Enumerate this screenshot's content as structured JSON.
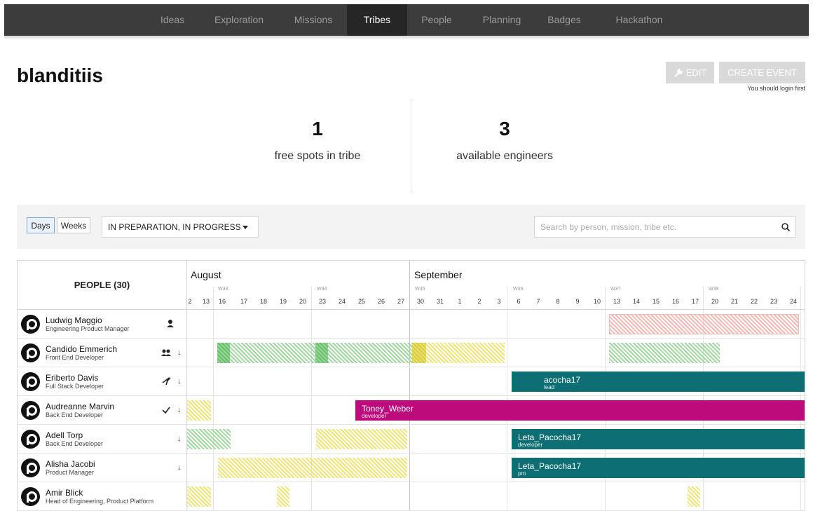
{
  "nav": {
    "items": [
      "Ideas",
      "Exploration",
      "Missions",
      "Tribes",
      "People",
      "Planning",
      "Badges",
      "Hackathon"
    ],
    "active": "Tribes"
  },
  "page": {
    "title": "blanditiis",
    "edit_label": "EDIT",
    "create_label": "CREATE EVENT",
    "login_note": "You should login first"
  },
  "stats": {
    "free_spots": "1",
    "free_spots_label": "free spots in tribe",
    "engineers": "3",
    "engineers_label": "available engineers"
  },
  "filters": {
    "days_label": "Days",
    "weeks_label": "Weeks",
    "active_toggle": "Days",
    "status_value": "IN PREPARATION, IN PROGRESS",
    "search_placeholder": "Search by person, mission, tribe etc."
  },
  "timeline": {
    "people_header": "PEOPLE (30)",
    "months": [
      "August",
      "September"
    ],
    "weeks": [
      "W33",
      "W34",
      "W35",
      "W36",
      "W37",
      "W38"
    ],
    "days": [
      "2",
      "13",
      "16",
      "17",
      "18",
      "19",
      "20",
      "23",
      "24",
      "25",
      "26",
      "27",
      "30",
      "31",
      "1",
      "2",
      "3",
      "6",
      "7",
      "8",
      "9",
      "10",
      "13",
      "14",
      "15",
      "16",
      "17",
      "20",
      "21",
      "22",
      "23",
      "24"
    ]
  },
  "people": [
    {
      "name": "Ludwig Maggio",
      "role": "Engineering Product Manager",
      "icon": "person-icon",
      "arrow": ""
    },
    {
      "name": "Candido Emmerich",
      "role": "Front End Developer",
      "icon": "group-icon",
      "arrow": "↓"
    },
    {
      "name": "Eriberto Davis",
      "role": "Full Stack Developer",
      "icon": "signature-icon",
      "arrow": "↓"
    },
    {
      "name": "Audreanne Marvin",
      "role": "Back End Developer",
      "icon": "check-icon",
      "arrow": "↓"
    },
    {
      "name": "Adell Torp",
      "role": "Back End Developer",
      "icon": "",
      "arrow": "↓"
    },
    {
      "name": "Alisha Jacobi",
      "role": "Product Manager",
      "icon": "",
      "arrow": "↓"
    },
    {
      "name": "Amir Blick",
      "role": "Head of Engineering, Product Platform",
      "icon": "",
      "arrow": ""
    }
  ],
  "assignments": {
    "eriberto": {
      "title": "acocha17",
      "sub": "lead"
    },
    "audreanne": {
      "title": "Toney_Weber",
      "sub": "developer"
    },
    "adell": {
      "title": "Leta_Pacocha17",
      "sub": "developer"
    },
    "alisha": {
      "title": "Leta_Pacocha17",
      "sub": "pm"
    }
  },
  "colors": {
    "teal": "#0d6e73",
    "magenta": "#bd0b7c",
    "nav_bg": "#3c3c3c",
    "nav_active": "#262626"
  }
}
